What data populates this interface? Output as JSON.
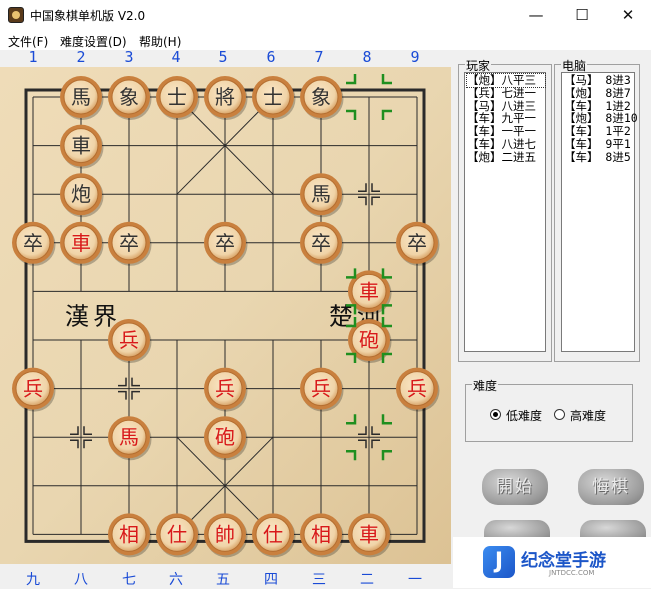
{
  "window": {
    "title": "中国象棋单机版 V2.0",
    "minimize": "—",
    "maximize": "☐",
    "close": "✕"
  },
  "menu": [
    {
      "label": "文件(F)"
    },
    {
      "label": "难度设置(D)"
    },
    {
      "label": "帮助(H)"
    }
  ],
  "file_numbers_top": [
    "1",
    "2",
    "3",
    "4",
    "5",
    "6",
    "7",
    "8",
    "9"
  ],
  "file_numbers_bottom": [
    "九",
    "八",
    "七",
    "六",
    "五",
    "四",
    "三",
    "二",
    "一"
  ],
  "river": {
    "left": "漢界",
    "right": "楚河"
  },
  "board": {
    "black_pieces": [
      {
        "char": "馬",
        "file": 1,
        "rank": 0
      },
      {
        "char": "象",
        "file": 2,
        "rank": 0
      },
      {
        "char": "士",
        "file": 3,
        "rank": 0
      },
      {
        "char": "將",
        "file": 4,
        "rank": 0
      },
      {
        "char": "士",
        "file": 5,
        "rank": 0
      },
      {
        "char": "象",
        "file": 6,
        "rank": 0
      },
      {
        "char": "車",
        "file": 1,
        "rank": 1
      },
      {
        "char": "炮",
        "file": 1,
        "rank": 2
      },
      {
        "char": "馬",
        "file": 6,
        "rank": 2
      },
      {
        "char": "卒",
        "file": 0,
        "rank": 3
      },
      {
        "char": "卒",
        "file": 2,
        "rank": 3
      },
      {
        "char": "卒",
        "file": 4,
        "rank": 3
      },
      {
        "char": "卒",
        "file": 6,
        "rank": 3
      },
      {
        "char": "卒",
        "file": 8,
        "rank": 3
      }
    ],
    "red_pieces": [
      {
        "char": "車",
        "file": 1,
        "rank": 3
      },
      {
        "char": "車",
        "file": 7,
        "rank": 4
      },
      {
        "char": "兵",
        "file": 2,
        "rank": 5
      },
      {
        "char": "砲",
        "file": 7,
        "rank": 5
      },
      {
        "char": "兵",
        "file": 0,
        "rank": 6
      },
      {
        "char": "兵",
        "file": 4,
        "rank": 6
      },
      {
        "char": "兵",
        "file": 6,
        "rank": 6
      },
      {
        "char": "兵",
        "file": 8,
        "rank": 6
      },
      {
        "char": "馬",
        "file": 2,
        "rank": 7
      },
      {
        "char": "砲",
        "file": 4,
        "rank": 7
      },
      {
        "char": "相",
        "file": 2,
        "rank": 9
      },
      {
        "char": "仕",
        "file": 3,
        "rank": 9
      },
      {
        "char": "帥",
        "file": 4,
        "rank": 9
      },
      {
        "char": "仕",
        "file": 5,
        "rank": 9
      },
      {
        "char": "相",
        "file": 6,
        "rank": 9
      },
      {
        "char": "車",
        "file": 7,
        "rank": 9
      }
    ],
    "point_markers": [
      {
        "file": 7,
        "rank": 2
      },
      {
        "file": 2,
        "rank": 6
      },
      {
        "file": 1,
        "rank": 7
      },
      {
        "file": 7,
        "rank": 7
      }
    ],
    "green_brackets": [
      {
        "file": 7,
        "rank": 0
      },
      {
        "file": 7,
        "rank": 4
      },
      {
        "file": 7,
        "rank": 5
      },
      {
        "file": 7,
        "rank": 7
      }
    ],
    "colors": {
      "wood": "#e9d6b0",
      "line": "#2a2a2a",
      "piece_face": "#f0d4a8",
      "piece_rim": "#c9803e",
      "black_text": "#333333",
      "red_text": "#d8191a",
      "selection": "#1f8f1f"
    }
  },
  "player_panel": {
    "title": "玩家",
    "moves": [
      "【炮】八平三",
      "【兵】七进一",
      "【马】八进三",
      "【车】九平一",
      "【车】一平一",
      "【车】八进七",
      "【炮】二进五"
    ]
  },
  "computer_panel": {
    "title": "电脑",
    "moves": [
      "【马】 8进3",
      "【炮】 8进7",
      "【车】 1进2",
      "【炮】 8进10",
      "【车】 1平2",
      "【车】 9平1",
      "【车】 8进5"
    ]
  },
  "difficulty": {
    "title": "难度",
    "options": [
      {
        "label": "低难度",
        "selected": true
      },
      {
        "label": "高难度",
        "selected": false
      }
    ]
  },
  "buttons": {
    "start": "開始",
    "undo": "悔棋"
  },
  "watermark": {
    "logo": "J",
    "text": "纪念堂手游",
    "sub": "JNTDCC.COM"
  }
}
